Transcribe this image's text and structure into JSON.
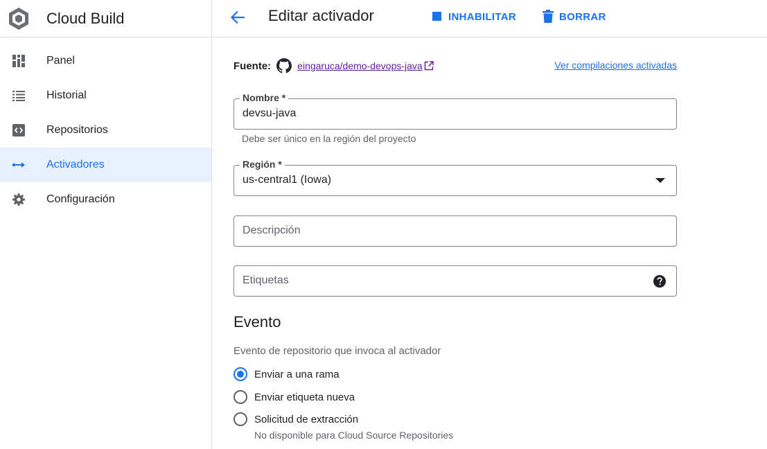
{
  "app": {
    "title": "Cloud Build",
    "logo_icon": "cloud-build-hexagon-icon"
  },
  "sidebar": {
    "items": [
      {
        "label": "Panel",
        "icon": "dashboard-icon",
        "active": false
      },
      {
        "label": "Historial",
        "icon": "list-icon",
        "active": false
      },
      {
        "label": "Repositorios",
        "icon": "code-box-icon",
        "active": false
      },
      {
        "label": "Activadores",
        "icon": "trigger-arrow-icon",
        "active": true
      },
      {
        "label": "Configuración",
        "icon": "gear-icon",
        "active": false
      }
    ]
  },
  "header": {
    "title": "Editar activador",
    "disable_label": "INHABILITAR",
    "delete_label": "BORRAR"
  },
  "form": {
    "source_label": "Fuente:",
    "repo_name": "eingaruca/demo-devops-java",
    "view_builds_link": "Ver compilaciones activadas",
    "name": {
      "label": "Nombre *",
      "value": "devsu-java",
      "hint": "Debe ser único en la región del proyecto"
    },
    "region": {
      "label": "Región *",
      "value": "us-central1 (Iowa)"
    },
    "description": {
      "placeholder": "Descripción"
    },
    "tags": {
      "placeholder": "Etiquetas"
    }
  },
  "event": {
    "title": "Evento",
    "subtitle": "Evento de repositorio que invoca al activador",
    "options": [
      {
        "label": "Enviar a una rama",
        "checked": true,
        "sub": ""
      },
      {
        "label": "Enviar etiqueta nueva",
        "checked": false,
        "sub": ""
      },
      {
        "label": "Solicitud de extracción",
        "checked": false,
        "sub": "No disponible para Cloud Source Repositories"
      }
    ]
  },
  "colors": {
    "accent": "#1a73e8",
    "active_bg": "#e8f0fe",
    "link_visited": "#681da8"
  }
}
